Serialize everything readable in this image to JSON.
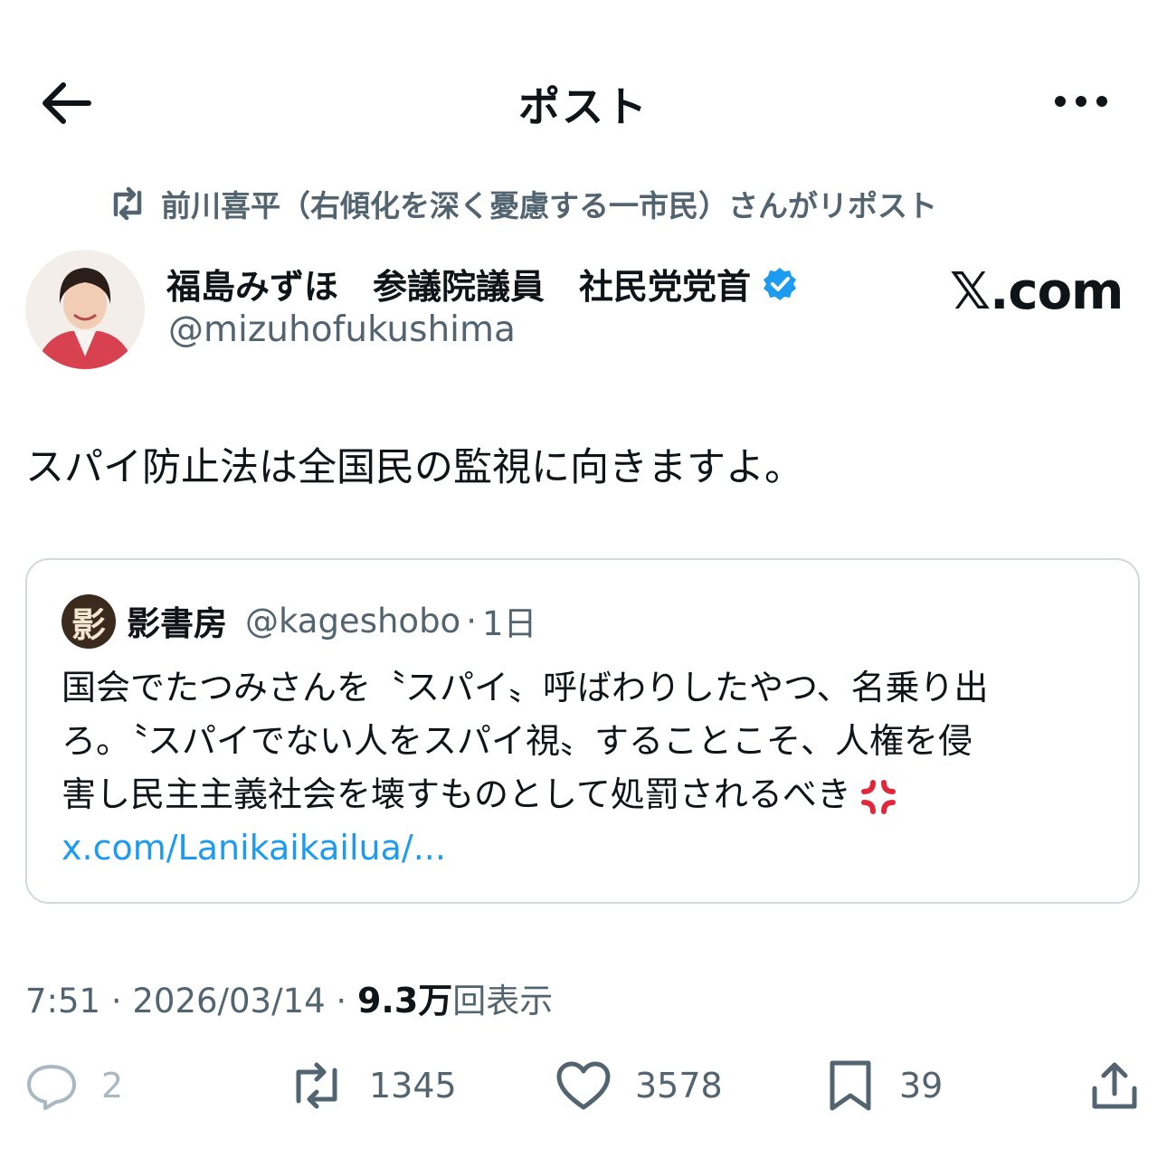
{
  "header": {
    "title": "ポスト",
    "back_icon": "back-arrow-icon",
    "more_icon": "more-dots-icon"
  },
  "repost": {
    "text": "前川喜平（右傾化を深く憂慮する一市民）さんがリポスト",
    "icon": "repost-icon"
  },
  "author": {
    "name": "福島みずほ　参議院議員　社民党党首",
    "handle": "@mizuhofukushima",
    "verified": true,
    "verified_color": "#1d9bf0"
  },
  "watermark": "𝕏.com",
  "post": {
    "text": "スパイ防止法は全国民の監視に向きますよ。"
  },
  "quote": {
    "avatar_char": "影",
    "name": "影書房",
    "handle": "@kageshobo",
    "separator": "·",
    "time": "1日",
    "lines": [
      "国会でたつみさんを〝スパイ〟呼ばわりしたやつ、名乗り出",
      "ろ。〝スパイでない人をスパイ視〟することこそ、人権を侵",
      "害し民主主義社会を壊すものとして処罰されるべき"
    ],
    "emoji": "anger-symbol-icon",
    "link": "x.com/Lanikaikailua/..."
  },
  "meta": {
    "time": "7:51",
    "sep1": " · ",
    "date": "2026/03/14",
    "sep2": " · ",
    "views": "9.3万",
    "views_label": "回表示"
  },
  "actions": {
    "replies": "2",
    "reposts": "1345",
    "likes": "3578",
    "bookmarks": "39"
  },
  "colors": {
    "link": "#1d9bf0",
    "secondary": "#536471",
    "border": "#cfd9de"
  }
}
